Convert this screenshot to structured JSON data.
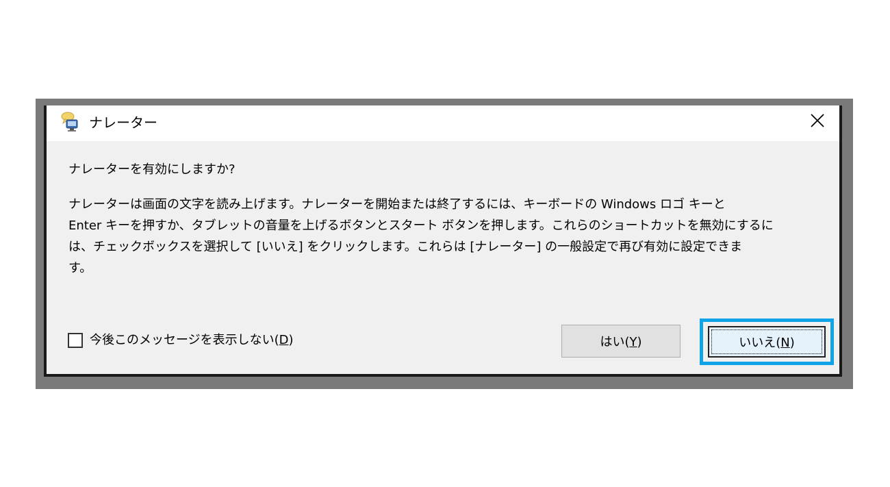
{
  "window": {
    "title": "ナレーター"
  },
  "dialog": {
    "question": "ナレーターを有効にしますか?",
    "body_lines": [
      "ナレーターは画面の文字を読み上げます。ナレーターを開始または終了するには、キーボードの Windows ロゴ キーと",
      "Enter キーを押すか、タブレットの音量を上げるボタンとスタート ボタンを押します。これらのショートカットを無効にするに",
      "は、チェックボックスを選択して [いいえ] をクリックします。これらは [ナレーター] の一般設定で再び有効に設定できま",
      "す。"
    ],
    "checkbox_label_prefix": "今後このメッセージを表示しない(",
    "checkbox_label_mnemonic": "D",
    "checkbox_label_suffix": ")",
    "checkbox_checked": false
  },
  "buttons": {
    "yes_prefix": "はい(",
    "yes_mnemonic": "Y",
    "yes_suffix": ")",
    "no_prefix": "いいえ(",
    "no_mnemonic": "N",
    "no_suffix": ")"
  },
  "icons": {
    "app": "narrator-icon",
    "close": "close-icon"
  },
  "colors": {
    "focus_ring": "#11a3e8",
    "dialog_bg": "#f0f0f0",
    "frame": "#7a7a7a"
  }
}
